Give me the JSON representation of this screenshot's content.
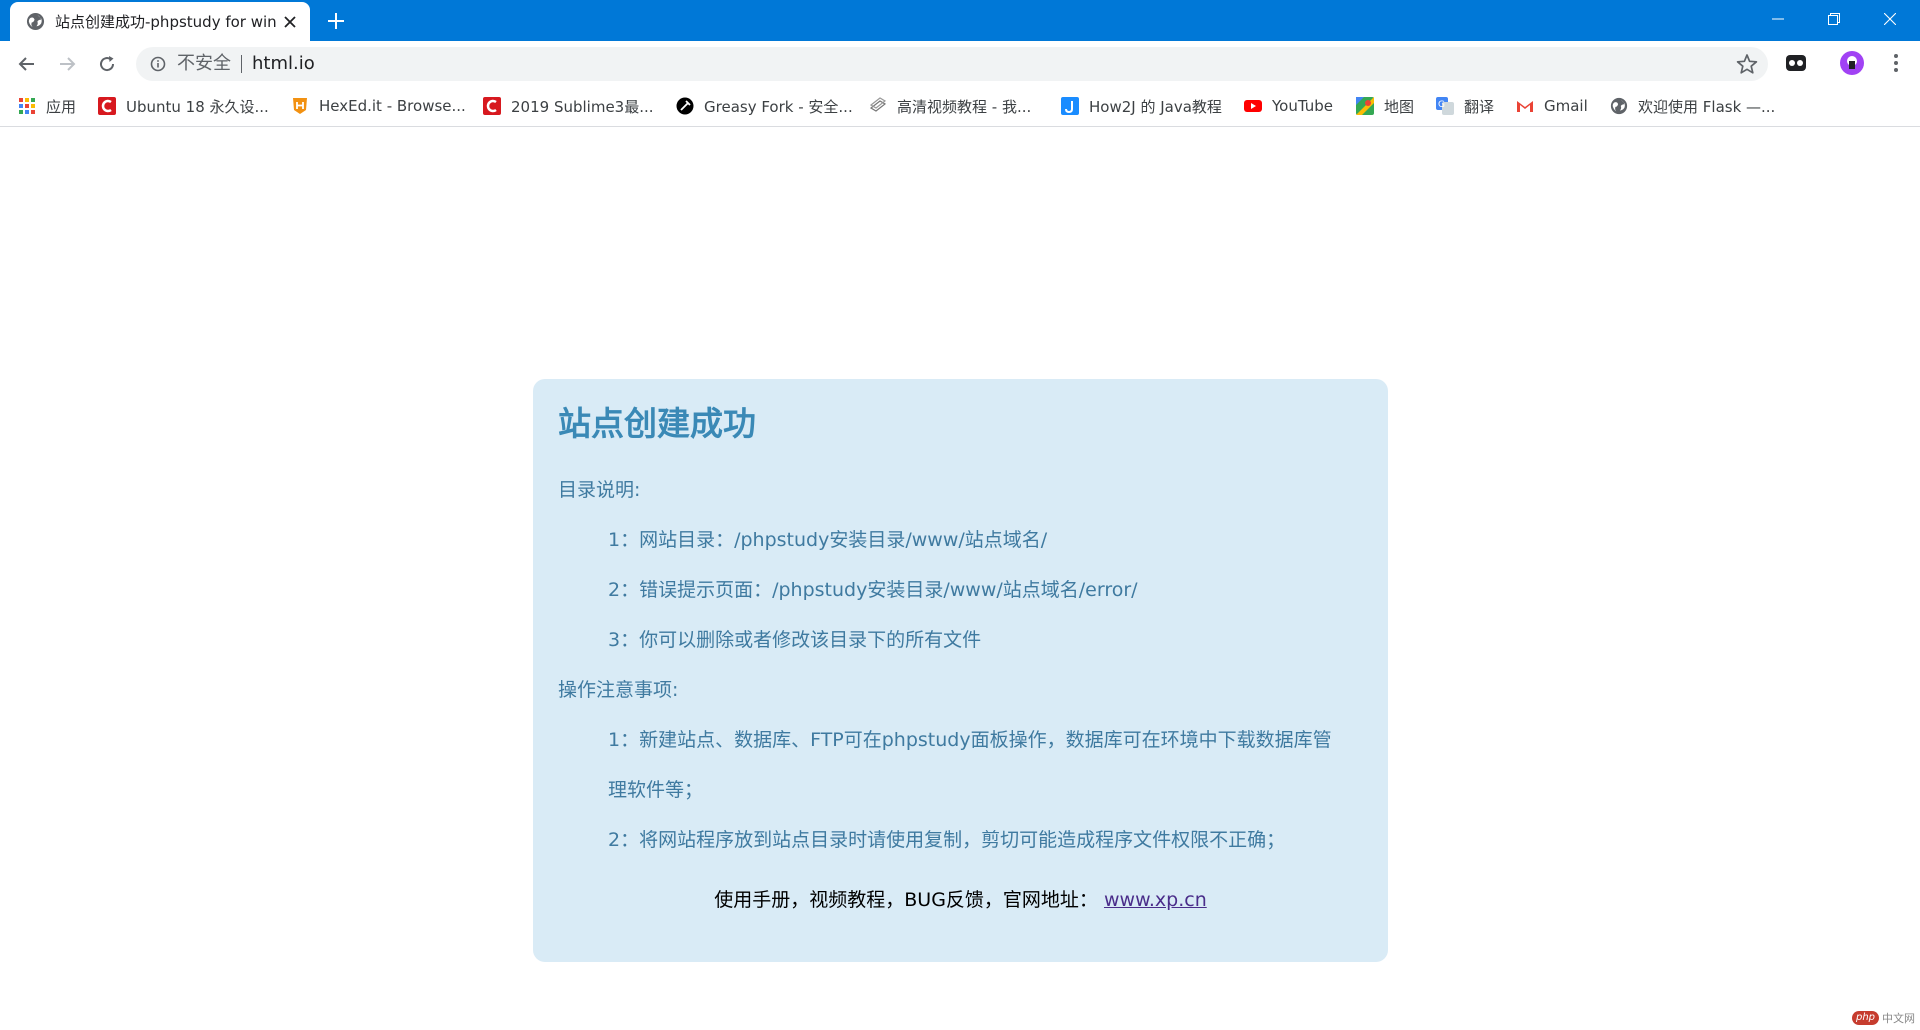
{
  "browser": {
    "tab": {
      "title": "站点创建成功-phpstudy for windows"
    },
    "address_bar": {
      "security_label": "不安全",
      "url": "html.io"
    },
    "bookmarks": [
      {
        "label": "应用",
        "icon": "apps-grid-icon"
      },
      {
        "label": "Ubuntu 18 永久设...",
        "icon": "c-logo-icon"
      },
      {
        "label": "HexEd.it - Browse...",
        "icon": "shield-logo-icon"
      },
      {
        "label": "2019 Sublime3最...",
        "icon": "c-logo-icon"
      },
      {
        "label": "Greasy Fork - 安全...",
        "icon": "greasyfork-icon"
      },
      {
        "label": "高清视频教程 - 我...",
        "icon": "layers-icon"
      },
      {
        "label": "How2J 的 Java教程",
        "icon": "how2j-icon"
      },
      {
        "label": "YouTube",
        "icon": "youtube-icon"
      },
      {
        "label": "地图",
        "icon": "maps-icon"
      },
      {
        "label": "翻译",
        "icon": "translate-icon"
      },
      {
        "label": "Gmail",
        "icon": "gmail-icon"
      },
      {
        "label": "欢迎使用 Flask —...",
        "icon": "globe-icon"
      }
    ]
  },
  "colors": {
    "titlebar": "#0078d7",
    "card_background": "#d9ebf6",
    "card_title": "#3a89b6",
    "card_text": "#3f7aa0"
  },
  "page": {
    "title": "站点创建成功",
    "directory_heading": "目录说明:",
    "directory_items": [
      "1：网站目录：/phpstudy安装目录/www/站点域名/",
      "2：错误提示页面：/phpstudy安装目录/www/站点域名/error/",
      "3：你可以删除或者修改该目录下的所有文件"
    ],
    "notes_heading": "操作注意事项:",
    "notes_item_1_line_1": "1：新建站点、数据库、FTP可在phpstudy面板操作，数据库可在环境中下载数据库管",
    "notes_item_1_line_2": "理软件等；",
    "notes_item_2": "2：将网站程序放到站点目录时请使用复制，剪切可能造成程序文件权限不正确；",
    "footer_text": "使用手册，视频教程，BUG反馈，官网地址：",
    "footer_link": "www.xp.cn"
  },
  "watermark": {
    "badge": "php",
    "text": "中文网"
  }
}
